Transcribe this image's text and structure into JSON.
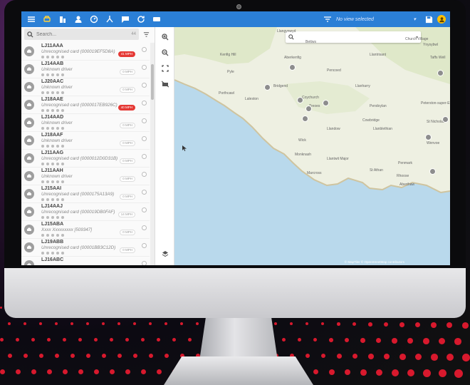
{
  "topbar": {
    "nav_icons": [
      "menu-icon",
      "vehicle-icon",
      "building-icon",
      "driver-icon",
      "dashboard-icon",
      "route-icon",
      "message-icon",
      "refresh-icon",
      "card-icon"
    ],
    "view_selector": "No view selected",
    "accent_color": "#2b7fd6"
  },
  "sidebar": {
    "search_placeholder": "Search...",
    "search_count": "44",
    "vehicles": [
      {
        "reg": "LJ11AAA",
        "driver": "Unrecognised card (000019EF5D8A)",
        "speed": "41 MPH",
        "alert": true
      },
      {
        "reg": "LJ14AAB",
        "driver": "Unknown driver",
        "speed": "0 MPH",
        "alert": false
      },
      {
        "reg": "LJ20AAC",
        "driver": "Unknown driver",
        "speed": "0 MPH",
        "alert": false
      },
      {
        "reg": "LJ18AAE",
        "driver": "Unrecognised card (0000017EB926C)",
        "speed": "40 MPH",
        "alert": true
      },
      {
        "reg": "LJ14AAD",
        "driver": "Unknown driver",
        "speed": "0 MPH",
        "alert": false
      },
      {
        "reg": "LJ18AAF",
        "driver": "Unknown driver",
        "speed": "0 MPH",
        "alert": false
      },
      {
        "reg": "LJ11AAG",
        "driver": "Unrecognised card (0000012D0D31B)",
        "speed": "0 MPH",
        "alert": false
      },
      {
        "reg": "LJ11AAH",
        "driver": "Unknown driver",
        "speed": "0 MPH",
        "alert": false
      },
      {
        "reg": "LJ15AAI",
        "driver": "Unrecognised card (0000175A13A9)",
        "speed": "0 MPH",
        "alert": false
      },
      {
        "reg": "LJ14AAJ",
        "driver": "Unrecognised card (000019DB0FAF)",
        "speed": "14 MPH",
        "alert": false
      },
      {
        "reg": "LJ15ABA",
        "driver": "Xxxx Xxxxxxxxx [509347]",
        "speed": "0 MPH",
        "alert": false
      },
      {
        "reg": "LJ19ABB",
        "driver": "Unrecognised card (00001BB3C12D)",
        "speed": "0 MPH",
        "alert": false
      },
      {
        "reg": "LJ16ABC",
        "driver": "",
        "speed": "",
        "alert": false
      }
    ]
  },
  "map": {
    "search_placeholder": "",
    "attribution": "© MapTiler © OpenStreetMap contributors",
    "places": [
      "Llangynwyd",
      "Bettws",
      "Church Village",
      "Ynysybwl",
      "Kenfig Hill",
      "Aberkenfig",
      "Llantrisant",
      "Taffs Well",
      "Pyle",
      "Pencoed",
      "Porthcawl",
      "Bridgend",
      "Llanharry",
      "Laleston",
      "Coychurch",
      "Treoes",
      "Pendoylan",
      "Peterston-super-Ely",
      "Cowbridge",
      "St Nicholas",
      "Llandow",
      "Llanblethian",
      "Wick",
      "Wenvoe",
      "Monknash",
      "Llantwit Major",
      "Penmark",
      "Rhoose",
      "St Athan",
      "Marcross",
      "Aberthaw"
    ]
  }
}
